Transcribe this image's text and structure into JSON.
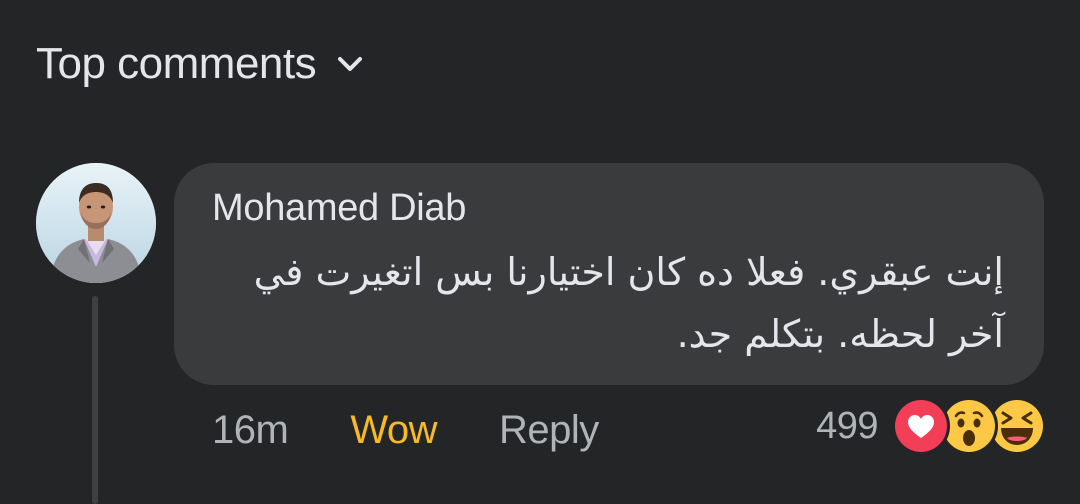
{
  "header": {
    "sort_label": "Top comments",
    "sort_icon": "chevron-down-icon"
  },
  "comment": {
    "author": "Mohamed Diab",
    "text": "إنت عبقري. فعلا ده كان اختيارنا بس اتغيرت في آخر لحظه. بتكلم جد.",
    "time": "16m",
    "reaction_label": "Wow",
    "reply_label": "Reply",
    "reaction_count": "499",
    "reaction_icons": [
      "love-icon",
      "wow-icon",
      "haha-icon"
    ]
  },
  "colors": {
    "background": "#242526",
    "bubble": "#3a3b3c",
    "wow_active": "#f7b928",
    "secondary_text": "#b0b3b8",
    "primary_text": "#e4e6eb",
    "love": "#f33e58",
    "emoji_yellow": "#fcc845"
  }
}
